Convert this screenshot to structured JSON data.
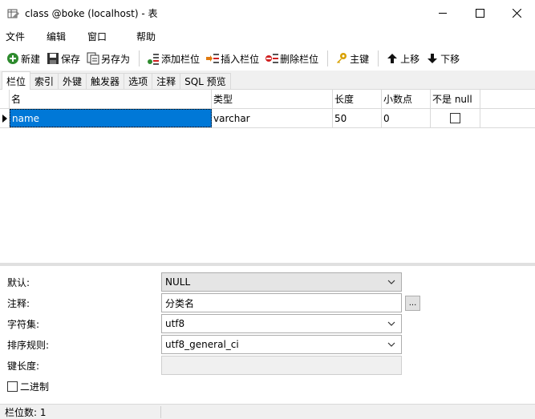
{
  "window": {
    "title": "class @boke (localhost) - 表"
  },
  "menu": [
    "文件",
    "编辑",
    "窗口",
    "帮助"
  ],
  "toolbar": {
    "new": "新建",
    "save": "保存",
    "save_as": "另存为",
    "add_field": "添加栏位",
    "insert_field": "插入栏位",
    "delete_field": "删除栏位",
    "primary_key": "主键",
    "move_up": "上移",
    "move_down": "下移"
  },
  "tabs": [
    "栏位",
    "索引",
    "外键",
    "触发器",
    "选项",
    "注释",
    "SQL 预览"
  ],
  "grid": {
    "headers": {
      "name": "名",
      "type": "类型",
      "length": "长度",
      "decimals": "小数点",
      "not_null": "不是 null"
    },
    "rows": [
      {
        "name": "name",
        "type": "varchar",
        "length": "50",
        "decimals": "0",
        "not_null": false
      }
    ]
  },
  "props": {
    "default_label": "默认:",
    "default_value": "NULL",
    "comment_label": "注释:",
    "comment_value": "分类名",
    "comment_button": "...",
    "charset_label": "字符集:",
    "charset_value": "utf8",
    "collation_label": "排序规则:",
    "collation_value": "utf8_general_ci",
    "keylen_label": "键长度:",
    "binary_label": "二进制"
  },
  "status": {
    "field_count": "栏位数: 1"
  },
  "colors": {
    "selection": "#0078d7",
    "add": "#2e8b2e",
    "insert": "#e07a10",
    "delete": "#d02020",
    "key": "#d8a000"
  }
}
